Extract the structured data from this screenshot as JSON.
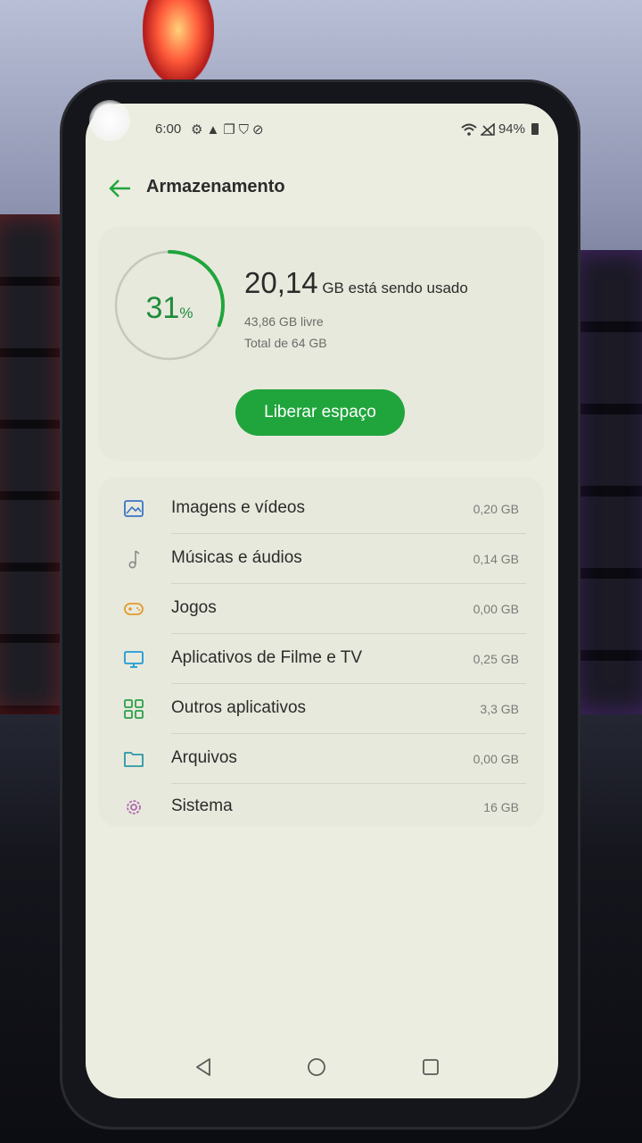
{
  "status_bar": {
    "time": "6:00",
    "battery": "94%",
    "left_icons": [
      "gear-icon",
      "warning-icon",
      "copy-icon",
      "shield-icon",
      "no-sim-icon"
    ],
    "right_icons": [
      "wifi-icon",
      "signal-icon",
      "battery-icon"
    ]
  },
  "header": {
    "title": "Armazenamento"
  },
  "summary": {
    "percent": "31",
    "percent_sign": "%",
    "percent_value": 0.31,
    "used_value": "20,14",
    "used_text": "GB está sendo usado",
    "free": "43,86 GB livre",
    "total": "Total de 64 GB",
    "button": "Liberar espaço"
  },
  "categories": [
    {
      "label": "Imagens e vídeos",
      "size": "0,20 GB",
      "icon": "image-icon"
    },
    {
      "label": "Músicas e áudios",
      "size": "0,14 GB",
      "icon": "music-note-icon"
    },
    {
      "label": "Jogos",
      "size": "0,00 GB",
      "icon": "gamepad-icon"
    },
    {
      "label": "Aplicativos de Filme e TV",
      "size": "0,25 GB",
      "icon": "tv-icon"
    },
    {
      "label": "Outros aplicativos",
      "size": "3,3 GB",
      "icon": "apps-grid-icon"
    },
    {
      "label": "Arquivos",
      "size": "0,00 GB",
      "icon": "folder-icon"
    },
    {
      "label": "Sistema",
      "size": "16 GB",
      "icon": "gear-icon"
    }
  ],
  "colors": {
    "accent": "#20a53c",
    "screen_bg": "#ecede1",
    "card_bg": "#e8e9dd",
    "icon_blue": "#3a74c4",
    "icon_orange": "#e39a2a",
    "icon_cyan": "#1e9bd4",
    "icon_green": "#2aa04a",
    "icon_teal": "#2a98a4",
    "icon_purple": "#b06ab0"
  }
}
